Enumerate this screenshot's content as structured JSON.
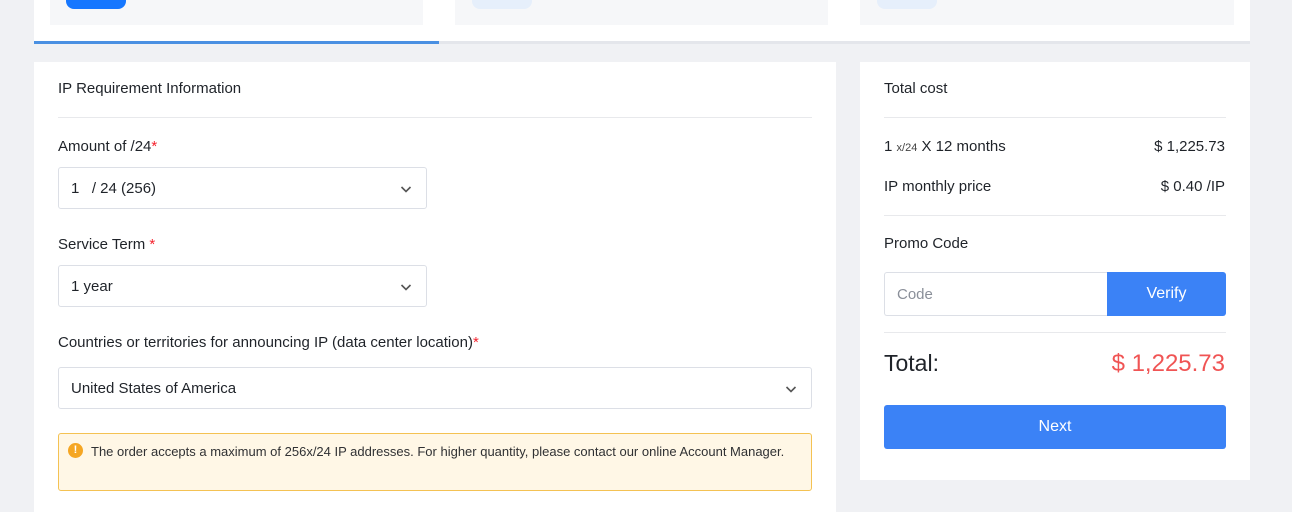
{
  "colors": {
    "primary": "#3b82f6",
    "required": "#f5222d",
    "total": "#f05454",
    "warning_bg": "#fff7e6",
    "warning_border": "#f4c253"
  },
  "steps": [
    {
      "state": "active"
    },
    {
      "state": "inactive"
    },
    {
      "state": "inactive"
    }
  ],
  "form": {
    "section_title": "IP Requirement Information",
    "amount": {
      "label": "Amount of /24",
      "required_mark": "*",
      "value": "1   / 24 (256)"
    },
    "term": {
      "label": "Service Term ",
      "required_mark": "*",
      "value": "1 year"
    },
    "country": {
      "label": "Countries or territories for announcing IP (data center location)",
      "required_mark": "*",
      "value": "United States of America"
    },
    "notice": {
      "icon": "exclamation-circle-icon",
      "icon_glyph": "!",
      "text": "The order accepts a maximum of 256x/24 IP addresses. For higher quantity, please contact our online Account Manager."
    }
  },
  "summary": {
    "title": "Total cost",
    "line1": {
      "qty": "1",
      "unit": "x/24",
      "suffix": "X 12 months",
      "value": "$ 1,225.73"
    },
    "line2": {
      "label": "IP monthly price",
      "value": "$ 0.40 /IP"
    },
    "promo_label": "Promo Code",
    "code_placeholder": "Code",
    "verify_label": "Verify",
    "total_label": "Total:",
    "total_value": "$ 1,225.73",
    "next_label": "Next"
  }
}
